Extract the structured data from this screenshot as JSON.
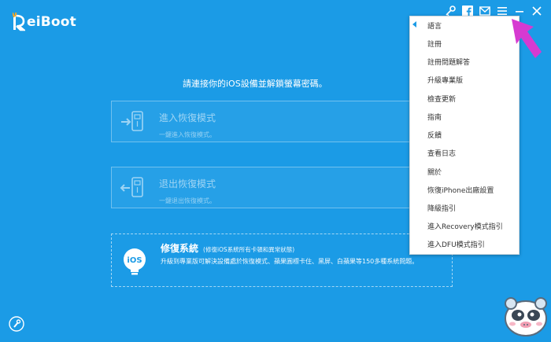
{
  "app": {
    "name": "ReiBoot",
    "name_rest": "eiBoot"
  },
  "titlebar": {
    "icons": [
      "key-icon",
      "facebook-icon",
      "mail-icon",
      "menu-icon",
      "minimize-icon",
      "close-icon"
    ]
  },
  "main": {
    "prompt": "請連接你的iOS設備並解鎖螢幕密碼。",
    "enter_mode": {
      "title": "進入恢復模式",
      "subtitle": "一鍵進入恢復模式。"
    },
    "exit_mode": {
      "title": "退出恢復模式",
      "subtitle": "一鍵退出恢復模式。"
    },
    "repair": {
      "title": "修復系統",
      "note": "(修復iOS系統所有卡頓和異常狀態)",
      "description": "升級到專業版可解決設備處於恢復模式、蘋果圓標卡住、黑屏、白蘋果等150多種系統問題。",
      "icon_text": "iOS"
    }
  },
  "menu": {
    "items": [
      "語言",
      "註冊",
      "註冊問題解答",
      "升級專業版",
      "檢查更新",
      "指南",
      "反饋",
      "查看日志",
      "關於",
      "恢復iPhone出廠設置",
      "降級指引",
      "進入Recovery模式指引",
      "進入DFU模式指引"
    ]
  },
  "colors": {
    "background": "#1b9be6",
    "menu_arrow": "#1b9be6",
    "pointer": "#d63ad1",
    "logo_accent": "#f5a623"
  }
}
